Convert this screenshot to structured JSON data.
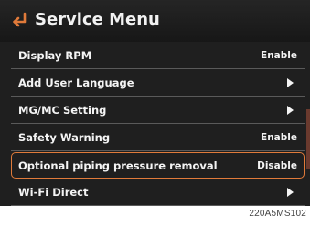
{
  "header": {
    "title": "Service Menu",
    "back_icon": "enter-return-arrow-icon"
  },
  "colors": {
    "accent": "#e07a3a",
    "background": "#1f1f1f",
    "text": "#f4f4f4"
  },
  "menu": {
    "items": [
      {
        "label": "Display RPM",
        "value": "Enable"
      },
      {
        "label": "Add User Language",
        "value": "",
        "icon": "chevron-right-icon"
      },
      {
        "label": "MG/MC Setting",
        "value": "",
        "icon": "chevron-right-icon"
      },
      {
        "label": "Safety Warning",
        "value": "Enable"
      },
      {
        "label": "Optional piping pressure removal",
        "value": "Disable",
        "selected": true
      },
      {
        "label": "Wi-Fi Direct",
        "value": "",
        "icon": "chevron-right-icon"
      }
    ]
  },
  "caption": "220A5MS102"
}
